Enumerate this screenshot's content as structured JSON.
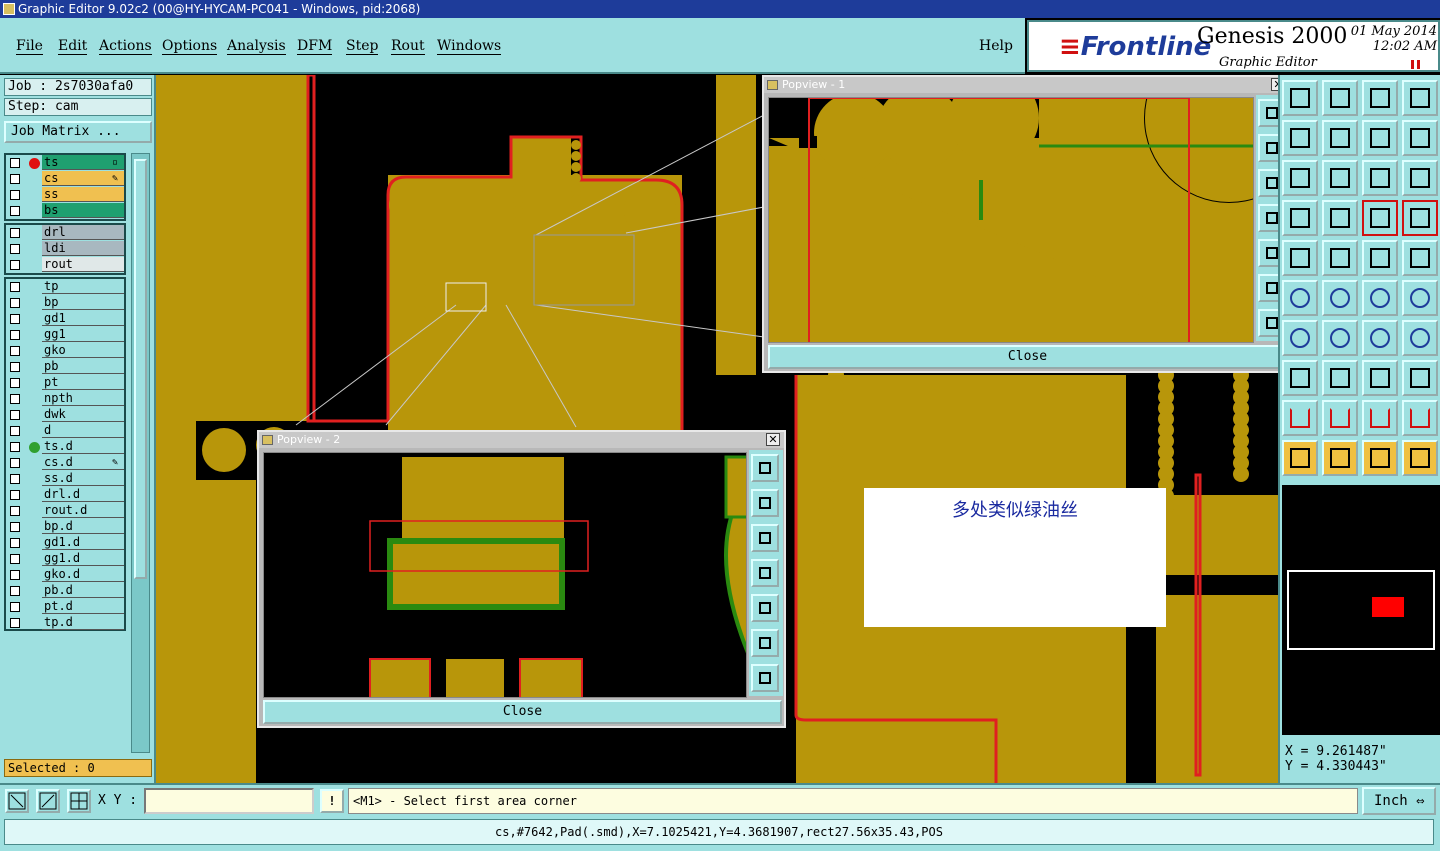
{
  "window": {
    "title": "Graphic Editor 9.02c2 (00@HY-HYCAM-PC041 - Windows, pid:2068)"
  },
  "menu": {
    "items": [
      "File",
      "Edit",
      "Actions",
      "Options",
      "Analysis",
      "DFM",
      "Step",
      "Rout",
      "Windows"
    ],
    "help": "Help"
  },
  "brand": {
    "logo_prefix": "≡",
    "logo": "Frontline",
    "product": "Genesis 2000",
    "subtitle": "Graphic Editor",
    "date": "01 May 2014",
    "time": "12:02 AM"
  },
  "job": {
    "job_line": "Job : 2s7030afa0",
    "step_line": "Step: cam",
    "matrix_button": "Job Matrix ..."
  },
  "layers": {
    "group1": [
      {
        "name": "ts",
        "color": "#1fa070",
        "dot": "#e01010",
        "mark": "▫"
      },
      {
        "name": "cs",
        "color": "#f0c050",
        "dot": "",
        "mark": "✎"
      },
      {
        "name": "ss",
        "color": "#f0c050",
        "dot": "",
        "mark": ""
      },
      {
        "name": "bs",
        "color": "#1fa070",
        "dot": "",
        "mark": ""
      }
    ],
    "group2": [
      {
        "name": "drl",
        "color": "#a8b8c0"
      },
      {
        "name": "ldi",
        "color": "#a8b8c0"
      },
      {
        "name": "rout",
        "color": "#e0e8e8"
      }
    ],
    "group3": [
      {
        "name": "tp"
      },
      {
        "name": "bp"
      },
      {
        "name": "gd1"
      },
      {
        "name": "gg1"
      },
      {
        "name": "gko"
      },
      {
        "name": "pb"
      },
      {
        "name": "pt"
      },
      {
        "name": "npth"
      },
      {
        "name": "dwk"
      },
      {
        "name": "d"
      },
      {
        "name": "ts.d",
        "dot": "#30a030"
      },
      {
        "name": "cs.d",
        "mark": "✎"
      },
      {
        "name": "ss.d"
      },
      {
        "name": "drl.d"
      },
      {
        "name": "rout.d"
      },
      {
        "name": "bp.d"
      },
      {
        "name": "gd1.d"
      },
      {
        "name": "gg1.d"
      },
      {
        "name": "gko.d"
      },
      {
        "name": "pb.d"
      },
      {
        "name": "pt.d"
      },
      {
        "name": "tp.d"
      }
    ]
  },
  "selected": "Selected : 0",
  "popview1": {
    "title": "Popview - 1",
    "close": "Close",
    "close_x": "✕"
  },
  "popview2": {
    "title": "Popview - 2",
    "close": "Close",
    "close_x": "✕"
  },
  "annotation": "多处类似绿油丝",
  "coords": {
    "x": "X =  9.261487\"",
    "y": "Y =  4.330443\""
  },
  "bottom": {
    "xy_label": "X Y :",
    "xy_value": "",
    "warn": "!",
    "prompt": "<M1> - Select first area corner",
    "units": "Inch"
  },
  "status": "cs,#7642,Pad(.smd),X=7.1025421,Y=4.3681907,rect27.56x35.43,POS",
  "colors": {
    "copper": "#b8960a",
    "outline": "#e02020",
    "mask": "#2a8a10",
    "panel": "#9ee0e0"
  }
}
